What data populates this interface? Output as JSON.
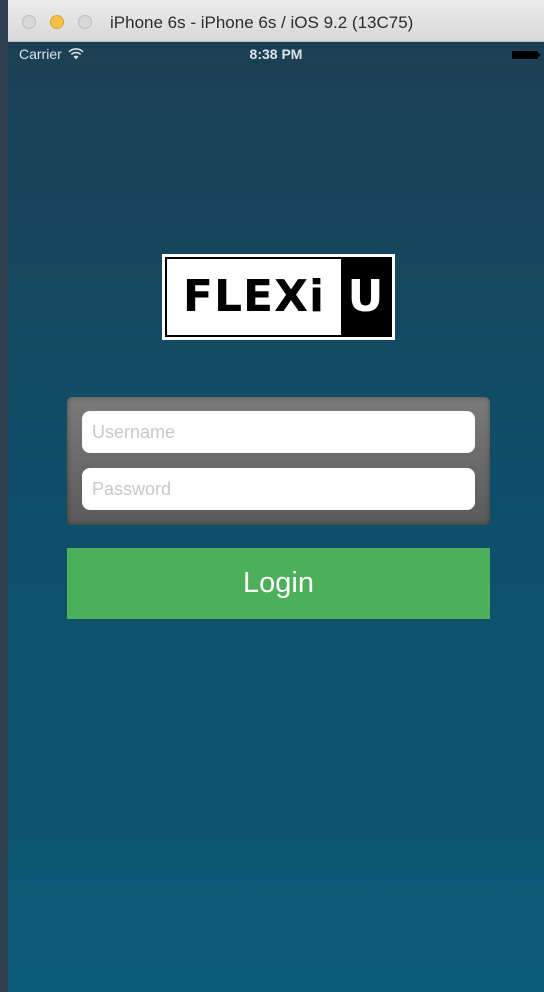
{
  "window": {
    "title": "iPhone 6s - iPhone 6s / iOS 9.2 (13C75)"
  },
  "statusbar": {
    "carrier": "Carrier",
    "time": "8:38 PM"
  },
  "logo": {
    "left_text": "FLEXi",
    "right_text": "U"
  },
  "form": {
    "username_placeholder": "Username",
    "password_placeholder": "Password",
    "username_value": "",
    "password_value": ""
  },
  "login": {
    "label": "Login"
  },
  "colors": {
    "login_button": "#4caf59",
    "background_top": "#1c3f53",
    "background_bottom": "#0b5a78"
  },
  "icons": [
    "wifi-icon",
    "battery-icon"
  ]
}
